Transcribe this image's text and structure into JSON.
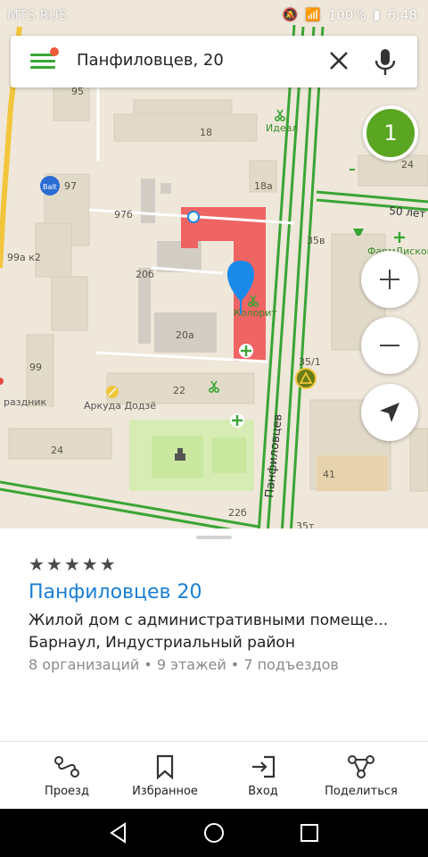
{
  "status": {
    "carrier": "MTS RUS",
    "battery": "100%",
    "time": "6:48"
  },
  "search": {
    "query": "Панфиловцев, 20"
  },
  "map": {
    "badge": "1",
    "house_numbers": [
      "95",
      "18",
      "97",
      "18а",
      "97б",
      "99а к2",
      "20б",
      "20а",
      "99",
      "22",
      "24",
      "41",
      "35/1",
      "35в",
      "22б",
      "35т",
      "24"
    ],
    "pois": {
      "ideal": "Идеал",
      "kolorit": "Колорит",
      "arkuda": "Аркуда Додзё",
      "prazdnik": "раздник",
      "farma": "ФармДисконт"
    },
    "streets": {
      "panfilovtsev": "Панфиловцев",
      "fifty_let": "50 лет"
    },
    "colors": {
      "road": "#3aa535",
      "highlight": "#e84a4a",
      "pin": "#1a8ae8"
    }
  },
  "card": {
    "stars": "★★★★★",
    "title": "Панфиловцев 20",
    "description": "Жилой дом с административными помеще...",
    "location": "Барнаул, Индустриальный район",
    "meta": "8 организаций • 9 этажей • 7 подъездов"
  },
  "actions": {
    "route": "Проезд",
    "favorites": "Избранное",
    "entrance": "Вход",
    "share": "Поделиться"
  }
}
